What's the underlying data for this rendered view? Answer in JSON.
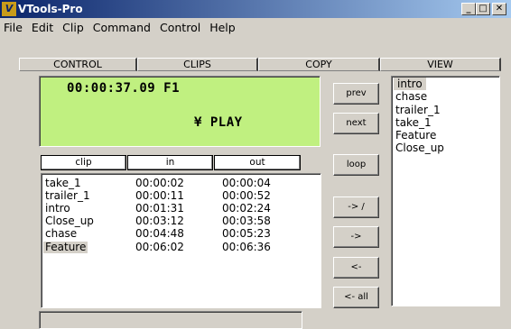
{
  "window": {
    "icon_text": "V",
    "title": "VTools-Pro",
    "minimize": "_",
    "maximize": "□",
    "close": "✕"
  },
  "menu": [
    "File",
    "Edit",
    "Clip",
    "Command",
    "Control",
    "Help"
  ],
  "tabs": [
    "CONTROL",
    "CLIPS",
    "COPY",
    "VIEW"
  ],
  "display": {
    "timecode": "00:00:37.09 F1",
    "status": "¥ PLAY",
    "background": "#c0f080"
  },
  "side_buttons": {
    "prev": "prev",
    "next": "next",
    "loop": "loop",
    "to_list": "-> /",
    "add": "->",
    "remove": "<-",
    "remove_all": "<- all"
  },
  "clip_table": {
    "headers": [
      "clip",
      "in",
      "out"
    ],
    "rows": [
      {
        "clip": "take_1",
        "in": "00:00:02",
        "out": "00:00:04"
      },
      {
        "clip": "trailer_1",
        "in": "00:00:11",
        "out": "00:00:52"
      },
      {
        "clip": "intro",
        "in": "00:01:31",
        "out": "00:02:24"
      },
      {
        "clip": "Close_up",
        "in": "00:03:12",
        "out": "00:03:58"
      },
      {
        "clip": "chase",
        "in": "00:04:48",
        "out": "00:05:23"
      },
      {
        "clip": "Feature",
        "in": "00:06:02",
        "out": "00:06:36",
        "selected": true
      }
    ]
  },
  "list": {
    "items": [
      "intro",
      "chase",
      "trailer_1",
      "take_1",
      "Feature",
      "Close_up"
    ],
    "selected_index": 0
  }
}
